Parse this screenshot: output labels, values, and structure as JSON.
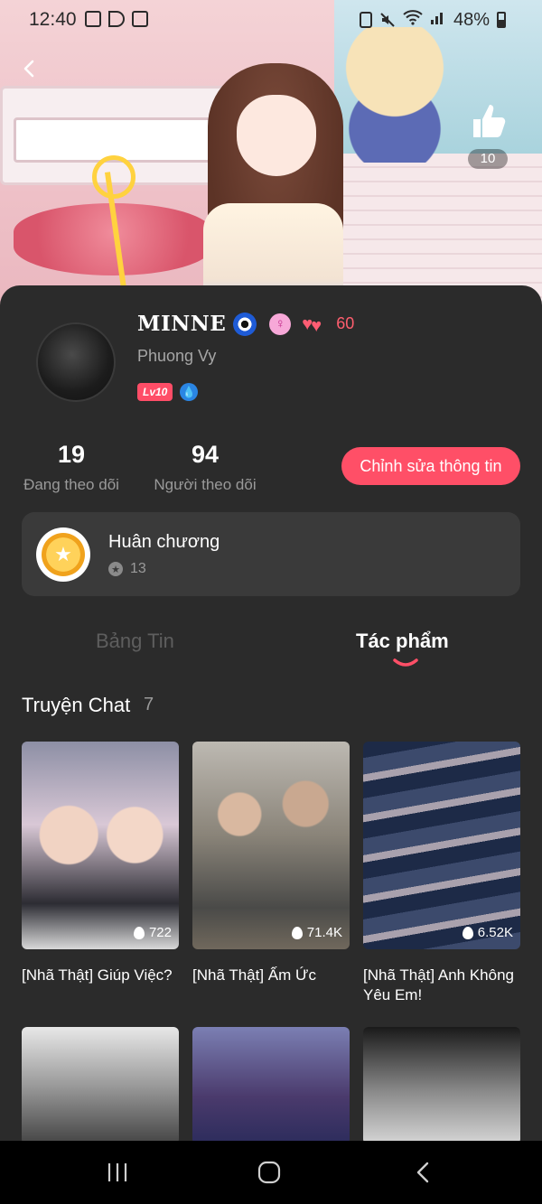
{
  "status_bar": {
    "time": "12:40",
    "battery": "48%"
  },
  "header": {
    "likes": "10"
  },
  "profile": {
    "name": "MINNE",
    "name_emoji": "nazar-eye-icon",
    "hearts_count": "60",
    "subname": "Phuong Vy",
    "level": "Lv10"
  },
  "stats": {
    "following_count": "19",
    "following_label": "Đang theo dõi",
    "followers_count": "94",
    "followers_label": "Người theo dõi"
  },
  "edit_button": "Chỉnh sửa thông tin",
  "medals": {
    "title": "Huân chương",
    "count": "13"
  },
  "tabs": [
    {
      "label": "Bảng Tin",
      "active": false
    },
    {
      "label": "Tác phẩm",
      "active": true
    }
  ],
  "section": {
    "title": "Truyện Chat",
    "count": "7"
  },
  "works": [
    {
      "views": "722",
      "title": "[Nhã Thật] Giúp Việc?"
    },
    {
      "views": "71.4K",
      "title": "[Nhã Thật] Ấm Ức"
    },
    {
      "views": "6.52K",
      "title": "[Nhã Thật] Anh Không Yêu Em!"
    }
  ],
  "colors": {
    "accent": "#ff4f67",
    "panel": "#2b2b2b",
    "card": "#3a3a3a"
  }
}
